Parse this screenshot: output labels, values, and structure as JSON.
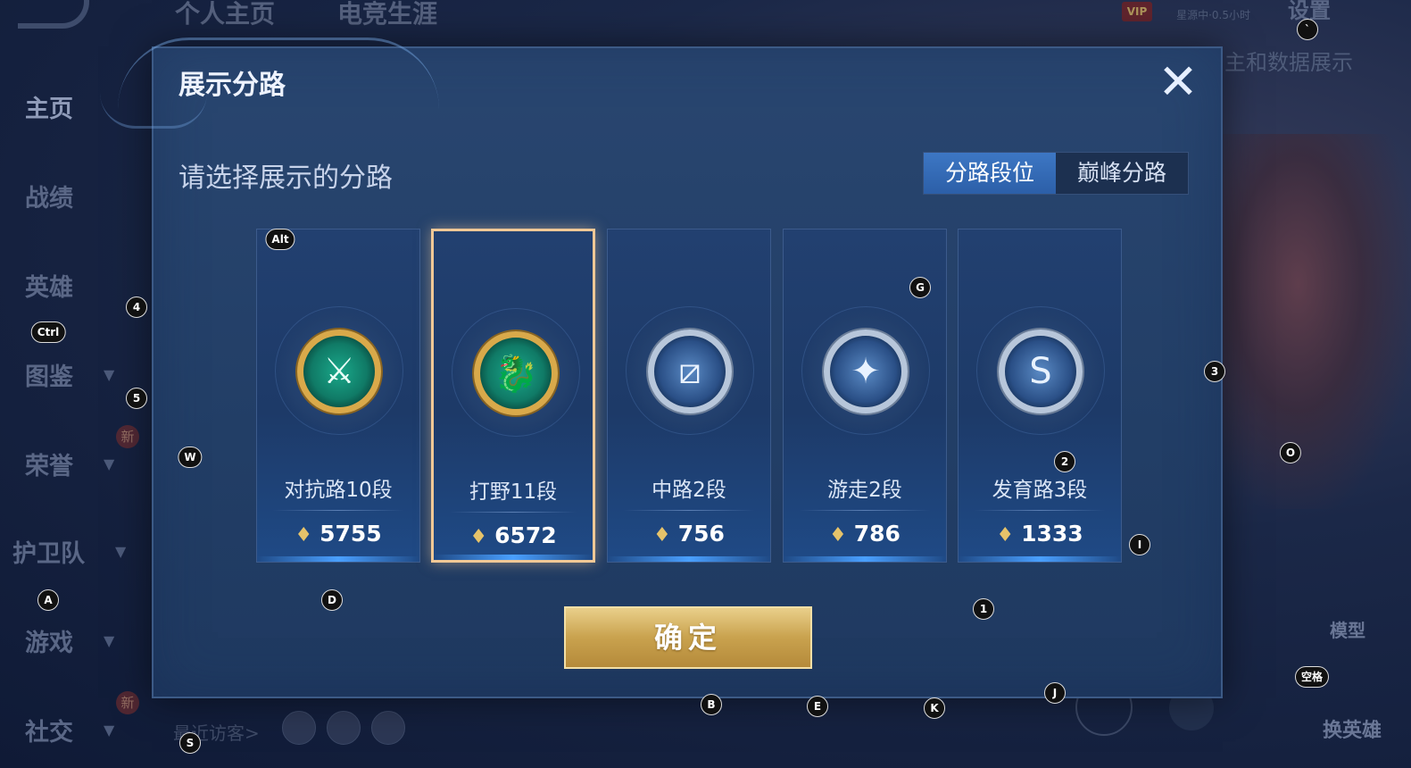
{
  "background": {
    "top_nav": [
      "个人主页",
      "电竞生涯"
    ],
    "sidebar": [
      {
        "label": "主页",
        "has_chevron": false,
        "active": true
      },
      {
        "label": "战绩",
        "has_chevron": false
      },
      {
        "label": "英雄",
        "has_chevron": false
      },
      {
        "label": "图鉴",
        "has_chevron": true
      },
      {
        "label": "荣誉",
        "has_chevron": true
      },
      {
        "label": "护卫队",
        "has_chevron": true
      },
      {
        "label": "游戏",
        "has_chevron": true
      },
      {
        "label": "社交",
        "has_chevron": true
      }
    ],
    "new_badge": "新",
    "vip_label": "VIP",
    "status_text": "星源中·0.5小时",
    "settings_label": "设置",
    "data_display_text": "主和数据展示",
    "model_label": "模型",
    "switch_hero_label": "换英雄",
    "recent_visitors_label": "最近访客>"
  },
  "modal": {
    "title": "展示分路",
    "close_icon": "close-x-icon",
    "subtitle": "请选择展示的分路",
    "tabs": [
      {
        "label": "分路段位",
        "active": true
      },
      {
        "label": "巅峰分路",
        "active": false
      }
    ],
    "lanes": [
      {
        "rank": "对抗路10段",
        "score": "5755",
        "icon": "clash-lane-icon",
        "tier": "gold",
        "glyph": "⚔",
        "selected": false
      },
      {
        "rank": "打野11段",
        "score": "6572",
        "icon": "jungle-dragon-icon",
        "tier": "gold",
        "glyph": "🐉",
        "selected": true
      },
      {
        "rank": "中路2段",
        "score": "756",
        "icon": "mid-lane-icon",
        "tier": "silver",
        "glyph": "⧄",
        "selected": false
      },
      {
        "rank": "游走2段",
        "score": "786",
        "icon": "roam-wings-icon",
        "tier": "silver",
        "glyph": "✦",
        "selected": false
      },
      {
        "rank": "发育路3段",
        "score": "1333",
        "icon": "farm-lane-icon",
        "tier": "silver",
        "glyph": "S",
        "selected": false
      }
    ],
    "confirm_label": "确定"
  },
  "key_hints": [
    {
      "key": "Alt"
    },
    {
      "key": "Ctrl"
    },
    {
      "key": "4"
    },
    {
      "key": "5"
    },
    {
      "key": "W"
    },
    {
      "key": "A"
    },
    {
      "key": "D"
    },
    {
      "key": "S"
    },
    {
      "key": "B"
    },
    {
      "key": "E"
    },
    {
      "key": "K"
    },
    {
      "key": "J"
    },
    {
      "key": "1"
    },
    {
      "key": "I"
    },
    {
      "key": "2"
    },
    {
      "key": "G"
    },
    {
      "key": "3"
    },
    {
      "key": "O"
    },
    {
      "key": "空格"
    },
    {
      "key": "`"
    }
  ]
}
